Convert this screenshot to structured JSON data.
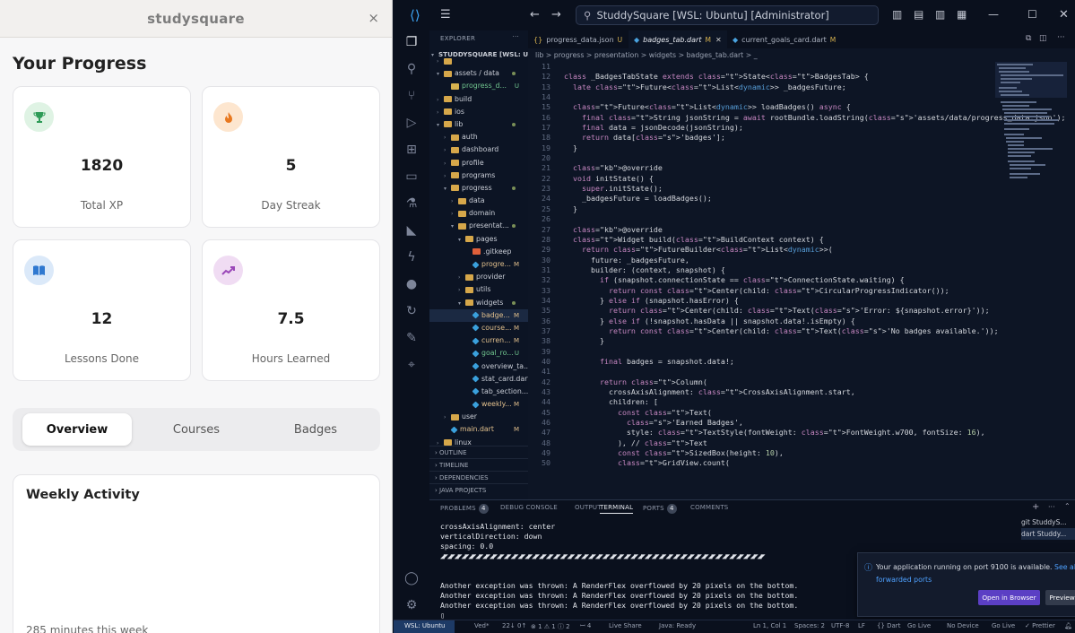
{
  "app": {
    "title": "studysquare",
    "close": "×",
    "heading": "Your Progress",
    "stats": [
      {
        "value": "1820",
        "label": "Total XP",
        "icon": "trophy-icon",
        "color": "#2e9b57",
        "bg": "#dff3e4"
      },
      {
        "value": "5",
        "label": "Day Streak",
        "icon": "fire-icon",
        "color": "#e8781f",
        "bg": "#fde6cf"
      },
      {
        "value": "12",
        "label": "Lessons Done",
        "icon": "book-icon",
        "color": "#2f78d0",
        "bg": "#dbe9f9"
      },
      {
        "value": "7.5",
        "label": "Hours Learned",
        "icon": "trend-icon",
        "color": "#9a47b8",
        "bg": "#f0dcf3"
      }
    ],
    "tabs": [
      "Overview",
      "Courses",
      "Badges"
    ],
    "weekly": {
      "title": "Weekly Activity",
      "summary": "285 minutes this week"
    }
  },
  "vscode": {
    "search_text": "StuddySquare [WSL: Ubuntu] [Administrator]",
    "explorer_label": "EXPLORER",
    "explorer_root": "STUDDYSQUARE [WSL: UB...",
    "tree": [
      {
        "name": "",
        "indent": 1,
        "kind": "folder",
        "open": false
      },
      {
        "name": "assets / data",
        "indent": 1,
        "kind": "folder",
        "open": true,
        "dot": true
      },
      {
        "name": "progress_d...",
        "indent": 2,
        "kind": "json",
        "status": "U"
      },
      {
        "name": "build",
        "indent": 1,
        "kind": "folder",
        "open": false
      },
      {
        "name": "ios",
        "indent": 1,
        "kind": "folder",
        "open": false
      },
      {
        "name": "lib",
        "indent": 1,
        "kind": "folder",
        "open": true,
        "dot": true
      },
      {
        "name": "auth",
        "indent": 2,
        "kind": "folder",
        "open": false
      },
      {
        "name": "dashboard",
        "indent": 2,
        "kind": "folder",
        "open": false
      },
      {
        "name": "profile",
        "indent": 2,
        "kind": "folder",
        "open": false
      },
      {
        "name": "programs",
        "indent": 2,
        "kind": "folder",
        "open": false
      },
      {
        "name": "progress",
        "indent": 2,
        "kind": "folder",
        "open": true,
        "dot": true
      },
      {
        "name": "data",
        "indent": 3,
        "kind": "folder",
        "open": false
      },
      {
        "name": "domain",
        "indent": 3,
        "kind": "folder",
        "open": false
      },
      {
        "name": "presentat...",
        "indent": 3,
        "kind": "folder",
        "open": true,
        "dot": true
      },
      {
        "name": "pages",
        "indent": 4,
        "kind": "folder",
        "open": true
      },
      {
        "name": ".gitkeep",
        "indent": 5,
        "kind": "git"
      },
      {
        "name": "progre...",
        "indent": 5,
        "kind": "dart",
        "status": "M"
      },
      {
        "name": "provider",
        "indent": 4,
        "kind": "folder",
        "open": false
      },
      {
        "name": "utils",
        "indent": 4,
        "kind": "folder",
        "open": false
      },
      {
        "name": "widgets",
        "indent": 4,
        "kind": "folder",
        "open": true,
        "dot": true
      },
      {
        "name": "badge...",
        "indent": 5,
        "kind": "dart",
        "status": "M",
        "selected": true
      },
      {
        "name": "course...",
        "indent": 5,
        "kind": "dart",
        "status": "M"
      },
      {
        "name": "curren...",
        "indent": 5,
        "kind": "dart",
        "status": "M"
      },
      {
        "name": "goal_ro...",
        "indent": 5,
        "kind": "dart",
        "status": "U"
      },
      {
        "name": "overview_ta...",
        "indent": 5,
        "kind": "dart"
      },
      {
        "name": "stat_card.dart",
        "indent": 5,
        "kind": "dart"
      },
      {
        "name": "tab_section...",
        "indent": 5,
        "kind": "dart"
      },
      {
        "name": "weekly...",
        "indent": 5,
        "kind": "dart",
        "status": "M"
      },
      {
        "name": "user",
        "indent": 2,
        "kind": "folder",
        "open": false
      },
      {
        "name": "main.dart",
        "indent": 2,
        "kind": "dart",
        "status": "M"
      },
      {
        "name": "linux",
        "indent": 1,
        "kind": "folder",
        "open": false
      }
    ],
    "sections": [
      "OUTLINE",
      "TIMELINE",
      "DEPENDENCIES",
      "JAVA PROJECTS"
    ],
    "editor_tabs": [
      {
        "name": "progress_data.json",
        "status": "U",
        "active": false
      },
      {
        "name": "badges_tab.dart",
        "status": "M",
        "active": true
      },
      {
        "name": "current_goals_card.dart",
        "status": "M",
        "active": false
      }
    ],
    "breadcrumb": "lib > progress > presentation > widgets > badges_tab.dart > _",
    "code": [
      {
        "n": "11",
        "t": ""
      },
      {
        "n": "12",
        "t": "class _BadgesTabState extends State<BadgesTab> {"
      },
      {
        "n": "13",
        "t": "  late Future<List<dynamic>> _badgesFuture;"
      },
      {
        "n": "14",
        "t": ""
      },
      {
        "n": "15",
        "t": "  Future<List<dynamic>> loadBadges() async {"
      },
      {
        "n": "16",
        "t": "    final String jsonString = await rootBundle.loadString('assets/data/progress_data.json');"
      },
      {
        "n": "17",
        "t": "    final data = jsonDecode(jsonString);"
      },
      {
        "n": "18",
        "t": "    return data['badges'];"
      },
      {
        "n": "19",
        "t": "  }"
      },
      {
        "n": "20",
        "t": ""
      },
      {
        "n": "21",
        "t": "  @override"
      },
      {
        "n": "22",
        "t": "  void initState() {"
      },
      {
        "n": "23",
        "t": "    super.initState();"
      },
      {
        "n": "24",
        "t": "    _badgesFuture = loadBadges();"
      },
      {
        "n": "25",
        "t": "  }"
      },
      {
        "n": "26",
        "t": ""
      },
      {
        "n": "27",
        "t": "  @override"
      },
      {
        "n": "28",
        "t": "  Widget build(BuildContext context) {"
      },
      {
        "n": "29",
        "t": "    return FutureBuilder<List<dynamic>>("
      },
      {
        "n": "30",
        "t": "      future: _badgesFuture,"
      },
      {
        "n": "31",
        "t": "      builder: (context, snapshot) {"
      },
      {
        "n": "32",
        "t": "        if (snapshot.connectionState == ConnectionState.waiting) {"
      },
      {
        "n": "33",
        "t": "          return const Center(child: CircularProgressIndicator());"
      },
      {
        "n": "34",
        "t": "        } else if (snapshot.hasError) {"
      },
      {
        "n": "35",
        "t": "          return Center(child: Text('Error: ${snapshot.error}'));"
      },
      {
        "n": "36",
        "t": "        } else if (!snapshot.hasData || snapshot.data!.isEmpty) {"
      },
      {
        "n": "37",
        "t": "          return const Center(child: Text('No badges available.'));"
      },
      {
        "n": "38",
        "t": "        }"
      },
      {
        "n": "39",
        "t": ""
      },
      {
        "n": "40",
        "t": "        final badges = snapshot.data!;"
      },
      {
        "n": "41",
        "t": ""
      },
      {
        "n": "42",
        "t": "        return Column("
      },
      {
        "n": "43",
        "t": "          crossAxisAlignment: CrossAxisAlignment.start,"
      },
      {
        "n": "44",
        "t": "          children: ["
      },
      {
        "n": "45",
        "t": "            const Text("
      },
      {
        "n": "46",
        "t": "              'Earned Badges',"
      },
      {
        "n": "47",
        "t": "              style: TextStyle(fontWeight: FontWeight.w700, fontSize: 16),"
      },
      {
        "n": "48",
        "t": "            ), // Text"
      },
      {
        "n": "49",
        "t": "            const SizedBox(height: 10),"
      },
      {
        "n": "50",
        "t": "            GridView.count("
      }
    ],
    "panel_tabs": [
      {
        "label": "PROBLEMS",
        "badge": "4"
      },
      {
        "label": "DEBUG CONSOLE"
      },
      {
        "label": "OUTPUT"
      },
      {
        "label": "TERMINAL",
        "active": true
      },
      {
        "label": "PORTS",
        "badge": "4"
      },
      {
        "label": "COMMENTS"
      }
    ],
    "terminal": [
      "crossAxisAlignment: center",
      "verticalDirection: down",
      "spacing: 0.0",
      "◢◤◢◤◢◤◢◤◢◤◢◤◢◤◢◤◢◤◢◤◢◤◢◤◢◤◢◤◢◤◢◤◢◤◢◤◢◤◢◤◢◤◢◤◢◤◢◤◢◤◢◤◢◤◢◤◢◤◢◤◢◤◢◤◢◤◢◤◢◤◢◤◢◤◢◤◢◤◢◤◢◤◢◤◢◤◢◤◢◤◢◤",
      "",
      "",
      "Another exception was thrown: A RenderFlex overflowed by 20 pixels on the bottom.",
      "Another exception was thrown: A RenderFlex overflowed by 20 pixels on the bottom.",
      "Another exception was thrown: A RenderFlex overflowed by 20 pixels on the bottom.",
      "▯"
    ],
    "terminal_list": [
      "git  StuddyS...",
      "dart  Studdy..."
    ],
    "notification": {
      "text": "Your application running on port 9100 is available.",
      "link": "See all forwarded ports",
      "open_btn": "Open in Browser",
      "preview_btn": "Preview in Editor"
    },
    "status": {
      "remote": "WSL: Ubuntu",
      "branch": "Ved*",
      "sync": "22↓ 0↑",
      "problems": "⊗ 1 ⚠ 1 ⓘ 2",
      "ports": "ꟷ 4",
      "liveshare": "Live Share",
      "java": "Java: Ready",
      "position": "Ln 1, Col 1",
      "spaces": "Spaces: 2",
      "encoding": "UTF-8",
      "eol": "LF",
      "lang": "{} Dart",
      "golive1": "Go Live",
      "device": "No Device",
      "golive2": "Go Live",
      "prettier": "✓ Prettier"
    }
  }
}
